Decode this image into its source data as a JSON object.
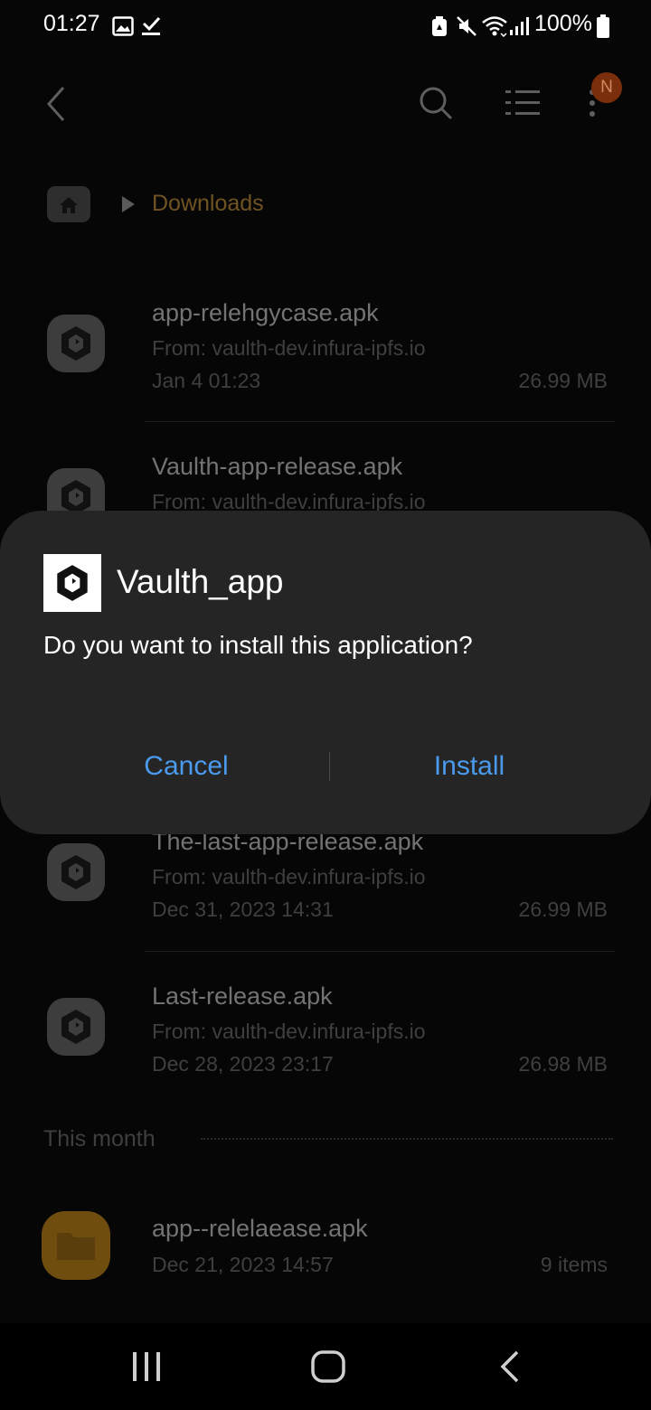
{
  "status_bar": {
    "time": "01:27",
    "battery": "100%",
    "icons": [
      "image-icon",
      "download-done-icon",
      "recycle-icon",
      "mute-icon",
      "wifi-icon",
      "signal-icon",
      "battery-icon"
    ]
  },
  "app_bar": {
    "avatar_initial": "N",
    "icons": [
      "back-icon",
      "search-icon",
      "list-view-icon",
      "more-icon"
    ]
  },
  "breadcrumb": {
    "current": "Downloads"
  },
  "files": [
    {
      "name": "app-relehgycase.apk",
      "source": "From: vaulth-dev.infura-ipfs.io",
      "date": "Jan 4 01:23",
      "size": "26.99 MB"
    },
    {
      "name": "Vaulth-app-release.apk",
      "source": "From: vaulth-dev.infura-ipfs.io"
    },
    {
      "name": "The-last-app-release.apk",
      "source": "From: vaulth-dev.infura-ipfs.io",
      "date": "Dec 31, 2023 14:31",
      "size": "26.99 MB"
    },
    {
      "name": "Last-release.apk",
      "source": "From: vaulth-dev.infura-ipfs.io",
      "date": "Dec 28, 2023 23:17",
      "size": "26.98 MB"
    }
  ],
  "section": {
    "label": "This month"
  },
  "folder": {
    "name": "app--relelaease.apk",
    "date": "Dec 21, 2023 14:57",
    "count": "9 items"
  },
  "dialog": {
    "app_name": "Vaulth_app",
    "message": "Do you want to install this application?",
    "cancel_label": "Cancel",
    "install_label": "Install"
  },
  "colors": {
    "accent": "#4a9aee",
    "dialog_bg": "#252525",
    "background": "#060606"
  }
}
